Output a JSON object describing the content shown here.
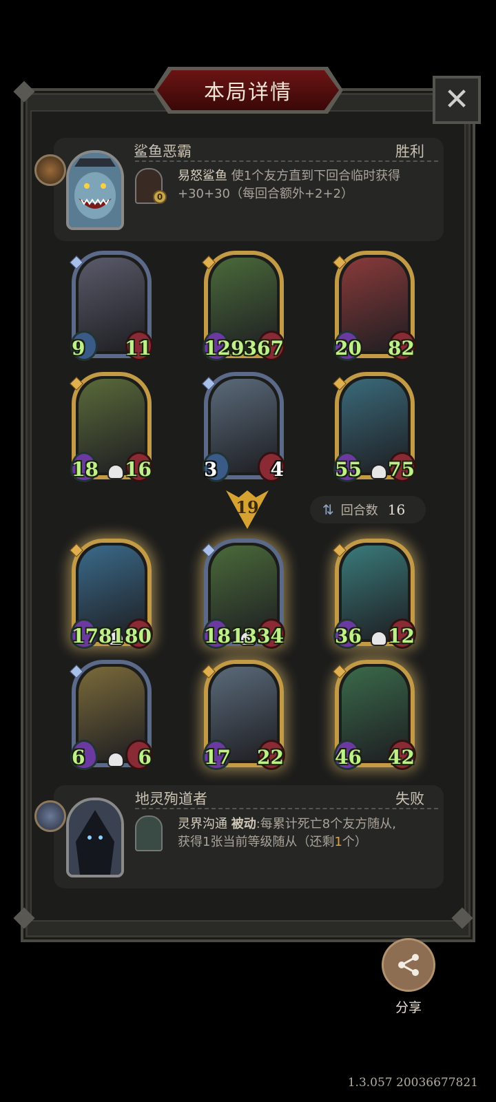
{
  "header": {
    "title": "本局详情",
    "close_icon": "close-icon"
  },
  "player_hero": {
    "name": "鲨鱼恶霸",
    "result": "胜利",
    "skill_cost": "0",
    "skill_name": "易怒鲨鱼",
    "skill_desc": "使1个友方直到下回合临时获得+30+30（每回合额外+2+2）"
  },
  "opponent_board": [
    {
      "atk": "9",
      "hp": "11",
      "tier": "silver"
    },
    {
      "atk": "129",
      "hp": "367",
      "tier": "gold"
    },
    {
      "atk": "20",
      "hp": "82",
      "tier": "gold"
    },
    {
      "atk": "18",
      "hp": "16",
      "tier": "gold",
      "skull": true
    },
    {
      "atk": "3",
      "hp": "4",
      "tier": "silver"
    },
    {
      "atk": "55",
      "hp": "75",
      "tier": "gold",
      "skull": true
    }
  ],
  "turn": {
    "number": "19"
  },
  "rounds": {
    "label": "回合数",
    "value": "16"
  },
  "player_board": [
    {
      "atk": "178",
      "hp": "180",
      "tier": "gold",
      "skull": true
    },
    {
      "atk": "181",
      "hp": "334",
      "tier": "silver",
      "skull": true
    },
    {
      "atk": "36",
      "hp": "12",
      "tier": "gold",
      "skull": true
    },
    {
      "atk": "6",
      "hp": "6",
      "tier": "silver",
      "skull": true
    },
    {
      "atk": "17",
      "hp": "22",
      "tier": "gold"
    },
    {
      "atk": "46",
      "hp": "42",
      "tier": "gold"
    }
  ],
  "opponent_hero": {
    "name": "地灵殉道者",
    "result": "失败",
    "skill_name": "灵界沟通",
    "skill_keyword": "被动",
    "skill_desc_1": ":每累计死亡8个友方随从,",
    "skill_desc_2a": "获得1张当前等级随从（还剩",
    "skill_remaining": "1",
    "skill_desc_2b": "个）"
  },
  "share": {
    "label": "分享",
    "icon": "share-icon"
  },
  "version": "1.3.057 20036677821"
}
